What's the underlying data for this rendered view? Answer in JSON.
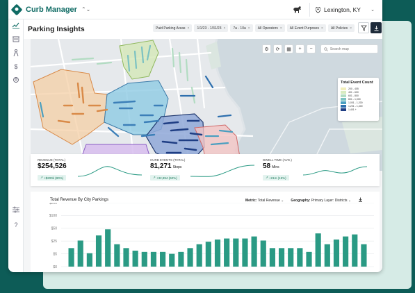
{
  "app": {
    "name": "Curb Manager",
    "location": "Lexington, KY"
  },
  "page": {
    "title": "Parking Insights",
    "filters": [
      "Paid Parking Areas",
      "1/1/23 - 1/31/23",
      "7a - 10a",
      "All Operators",
      "All Event Purposes",
      "All Policies"
    ]
  },
  "sidebar": {
    "icons": [
      "chart-line-icon",
      "building-icon",
      "person-icon",
      "dollar-icon",
      "group-icon",
      "sliders-icon",
      "help-icon"
    ]
  },
  "map": {
    "search_placeholder": "Search map",
    "controls": [
      "settings-icon",
      "refresh-icon",
      "layers-icon",
      "zoom-in-icon",
      "zoom-out-icon"
    ],
    "legend": {
      "title": "Total Event Count",
      "items": [
        {
          "label": "200 - 405",
          "color": "#f1eebb"
        },
        {
          "label": "401 - 600",
          "color": "#d7ebc0"
        },
        {
          "label": "601 - 800",
          "color": "#b2dcc2"
        },
        {
          "label": "801 - 1,000",
          "color": "#7cc2c2"
        },
        {
          "label": "1,001 - 1,200",
          "color": "#4a9fc0"
        },
        {
          "label": "1,201 - 1,400",
          "color": "#2e6fae"
        },
        {
          "label": "1,401 +",
          "color": "#1f3e84"
        }
      ]
    }
  },
  "stats": [
    {
      "label": "REVENUE (TOTAL)",
      "value": "$254,526",
      "unit": "",
      "delta": "+$200k (80%)"
    },
    {
      "label": "CURB EVENTS (TOTAL)",
      "value": "81,271",
      "unit": "Stops",
      "delta": "+32,894 (60%)"
    },
    {
      "label": "DWELL TIME (AVG.)",
      "value": "58",
      "unit": "Mins",
      "delta": "+21m (15%)"
    }
  ],
  "chart_panel": {
    "title": "Total Revenue By City Parkings",
    "metric_label": "Metric:",
    "metric_value": "Total Revenue",
    "geography_label": "Geography:",
    "geography_value": "Primary Layer: Districts"
  },
  "chart_data": {
    "type": "bar",
    "title": "Total Revenue By City Parkings",
    "xlabel": "",
    "ylabel": "",
    "yticks": [
      "$200",
      "$100",
      "$50",
      "$25",
      "$5",
      "$0"
    ],
    "ytick_values": [
      200,
      100,
      50,
      25,
      5,
      0
    ],
    "scale": "nonlinear",
    "color": "#2a9a84",
    "values": [
      14,
      26,
      6,
      36,
      48,
      20,
      14,
      10,
      8,
      8,
      8,
      5,
      8,
      14,
      20,
      24,
      28,
      30,
      30,
      30,
      34,
      26,
      14,
      14,
      14,
      14,
      8,
      40,
      20,
      28,
      34,
      38,
      20
    ]
  }
}
